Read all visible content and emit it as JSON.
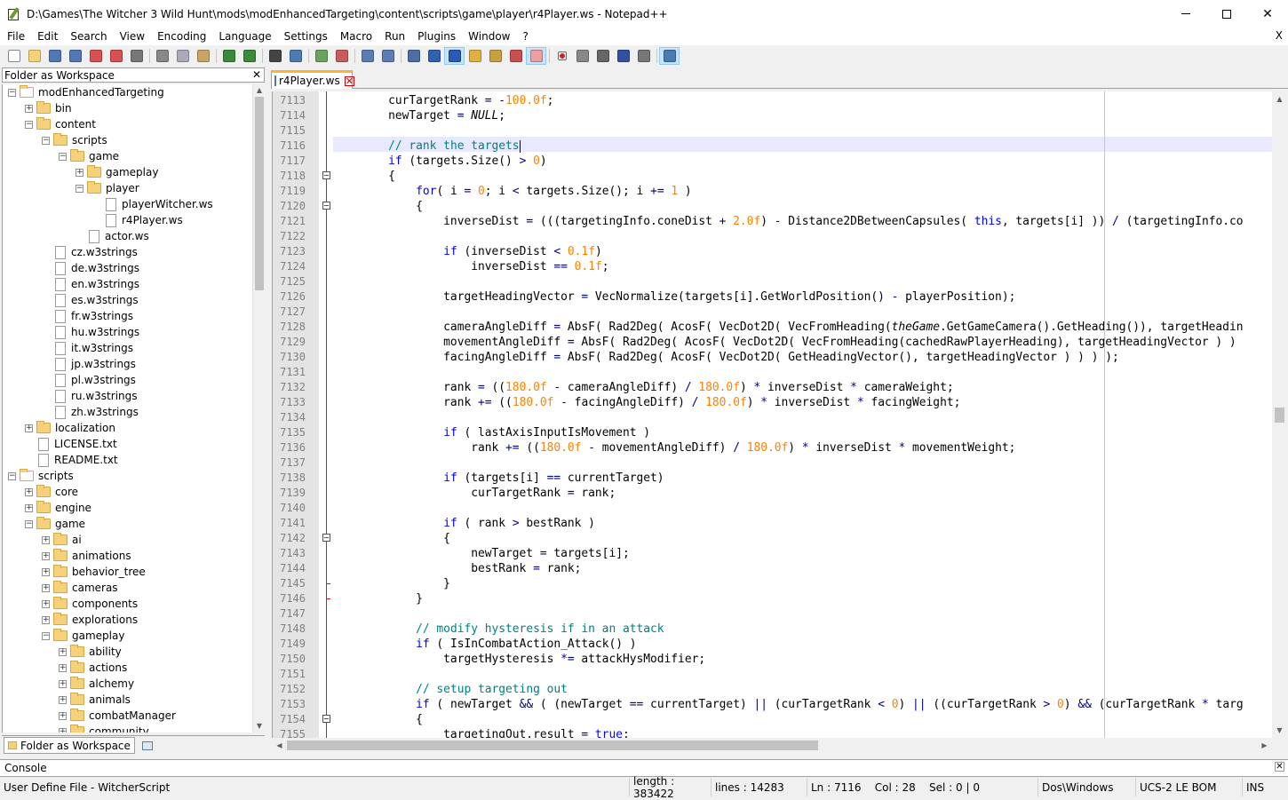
{
  "window": {
    "title": "D:\\Games\\The Witcher 3 Wild Hunt\\mods\\modEnhancedTargeting\\content\\scripts\\game\\player\\r4Player.ws - Notepad++"
  },
  "menu": [
    "File",
    "Edit",
    "Search",
    "View",
    "Encoding",
    "Language",
    "Settings",
    "Macro",
    "Run",
    "Plugins",
    "Window",
    "?"
  ],
  "menu_close_doc": "X",
  "toolbar_icons": [
    "new-file-icon",
    "open-file-icon",
    "save-icon",
    "save-all-icon",
    "close-icon",
    "close-all-icon",
    "print-icon",
    "cut-icon",
    "copy-icon",
    "paste-icon",
    "undo-icon",
    "redo-icon",
    "find-icon",
    "replace-icon",
    "zoom-in-icon",
    "zoom-out-icon",
    "sync-vertical-icon",
    "sync-horizontal-icon",
    "word-wrap-icon",
    "show-all-chars-icon",
    "indent-guide-icon",
    "user-language-icon",
    "document-map-icon",
    "function-list-icon",
    "folder-as-workspace-icon",
    "record-macro-icon",
    "stop-macro-icon",
    "play-macro-icon",
    "run-macro-multiple-icon",
    "save-macro-icon",
    "monitoring-icon"
  ],
  "panel": {
    "title": "Folder as Workspace",
    "close": "✕",
    "tab_label": "Folder as Workspace",
    "tree": [
      {
        "label": "modEnhancedTargeting",
        "depth": 0,
        "kind": "folder",
        "exp": "−"
      },
      {
        "label": "bin",
        "depth": 1,
        "kind": "folder",
        "exp": "+"
      },
      {
        "label": "content",
        "depth": 1,
        "kind": "folder",
        "exp": "−"
      },
      {
        "label": "scripts",
        "depth": 2,
        "kind": "folder",
        "exp": "−"
      },
      {
        "label": "game",
        "depth": 3,
        "kind": "folder",
        "exp": "−"
      },
      {
        "label": "gameplay",
        "depth": 4,
        "kind": "folder",
        "exp": "+"
      },
      {
        "label": "player",
        "depth": 4,
        "kind": "folder",
        "exp": "−"
      },
      {
        "label": "playerWitcher.ws",
        "depth": 5,
        "kind": "file",
        "exp": ""
      },
      {
        "label": "r4Player.ws",
        "depth": 5,
        "kind": "file",
        "exp": ""
      },
      {
        "label": "actor.ws",
        "depth": 4,
        "kind": "file",
        "exp": ""
      },
      {
        "label": "cz.w3strings",
        "depth": 2,
        "kind": "file",
        "exp": ""
      },
      {
        "label": "de.w3strings",
        "depth": 2,
        "kind": "file",
        "exp": ""
      },
      {
        "label": "en.w3strings",
        "depth": 2,
        "kind": "file",
        "exp": ""
      },
      {
        "label": "es.w3strings",
        "depth": 2,
        "kind": "file",
        "exp": ""
      },
      {
        "label": "fr.w3strings",
        "depth": 2,
        "kind": "file",
        "exp": ""
      },
      {
        "label": "hu.w3strings",
        "depth": 2,
        "kind": "file",
        "exp": ""
      },
      {
        "label": "it.w3strings",
        "depth": 2,
        "kind": "file",
        "exp": ""
      },
      {
        "label": "jp.w3strings",
        "depth": 2,
        "kind": "file",
        "exp": ""
      },
      {
        "label": "pl.w3strings",
        "depth": 2,
        "kind": "file",
        "exp": ""
      },
      {
        "label": "ru.w3strings",
        "depth": 2,
        "kind": "file",
        "exp": ""
      },
      {
        "label": "zh.w3strings",
        "depth": 2,
        "kind": "file",
        "exp": ""
      },
      {
        "label": "localization",
        "depth": 1,
        "kind": "folder",
        "exp": "+"
      },
      {
        "label": "LICENSE.txt",
        "depth": 1,
        "kind": "file",
        "exp": ""
      },
      {
        "label": "README.txt",
        "depth": 1,
        "kind": "file",
        "exp": ""
      },
      {
        "label": "scripts",
        "depth": 0,
        "kind": "folder",
        "exp": "−"
      },
      {
        "label": "core",
        "depth": 1,
        "kind": "folder",
        "exp": "+"
      },
      {
        "label": "engine",
        "depth": 1,
        "kind": "folder",
        "exp": "+"
      },
      {
        "label": "game",
        "depth": 1,
        "kind": "folder",
        "exp": "−"
      },
      {
        "label": "ai",
        "depth": 2,
        "kind": "folder",
        "exp": "+"
      },
      {
        "label": "animations",
        "depth": 2,
        "kind": "folder",
        "exp": "+"
      },
      {
        "label": "behavior_tree",
        "depth": 2,
        "kind": "folder",
        "exp": "+"
      },
      {
        "label": "cameras",
        "depth": 2,
        "kind": "folder",
        "exp": "+"
      },
      {
        "label": "components",
        "depth": 2,
        "kind": "folder",
        "exp": "+"
      },
      {
        "label": "explorations",
        "depth": 2,
        "kind": "folder",
        "exp": "+"
      },
      {
        "label": "gameplay",
        "depth": 2,
        "kind": "folder",
        "exp": "−"
      },
      {
        "label": "ability",
        "depth": 3,
        "kind": "folder",
        "exp": "+"
      },
      {
        "label": "actions",
        "depth": 3,
        "kind": "folder",
        "exp": "+"
      },
      {
        "label": "alchemy",
        "depth": 3,
        "kind": "folder",
        "exp": "+"
      },
      {
        "label": "animals",
        "depth": 3,
        "kind": "folder",
        "exp": "+"
      },
      {
        "label": "combatManager",
        "depth": 3,
        "kind": "folder",
        "exp": "+"
      },
      {
        "label": "community",
        "depth": 3,
        "kind": "folder",
        "exp": "+"
      }
    ]
  },
  "editor": {
    "tab": "r4Player.ws",
    "lines": [
      {
        "n": "7113",
        "text": "\t\tcurTargetRank = -100.0f;"
      },
      {
        "n": "7114",
        "text": "\t\tnewTarget = NULL;"
      },
      {
        "n": "7115",
        "text": ""
      },
      {
        "n": "7116",
        "text": "\t\t// rank the targets"
      },
      {
        "n": "7117",
        "text": "\t\tif (targets.Size() > 0)"
      },
      {
        "n": "7118",
        "text": "\t\t{"
      },
      {
        "n": "7119",
        "text": "\t\t\tfor( i = 0; i < targets.Size(); i += 1 )"
      },
      {
        "n": "7120",
        "text": "\t\t\t{"
      },
      {
        "n": "7121",
        "text": "\t\t\t\tinverseDist = (((targetingInfo.coneDist + 2.0f) - Distance2DBetweenCapsules( this, targets[i] )) / (targetingInfo.co"
      },
      {
        "n": "7122",
        "text": ""
      },
      {
        "n": "7123",
        "text": "\t\t\t\tif (inverseDist < 0.1f)"
      },
      {
        "n": "7124",
        "text": "\t\t\t\t\tinverseDist == 0.1f;"
      },
      {
        "n": "7125",
        "text": ""
      },
      {
        "n": "7126",
        "text": "\t\t\t\ttargetHeadingVector = VecNormalize(targets[i].GetWorldPosition() - playerPosition);"
      },
      {
        "n": "7127",
        "text": ""
      },
      {
        "n": "7128",
        "text": "\t\t\t\tcameraAngleDiff = AbsF( Rad2Deg( AcosF( VecDot2D( VecFromHeading(theGame.GetGameCamera().GetHeading()), targetHeadin"
      },
      {
        "n": "7129",
        "text": "\t\t\t\tmovementAngleDiff = AbsF( Rad2Deg( AcosF( VecDot2D( VecFromHeading(cachedRawPlayerHeading), targetHeadingVector ) )"
      },
      {
        "n": "7130",
        "text": "\t\t\t\tfacingAngleDiff = AbsF( Rad2Deg( AcosF( VecDot2D( GetHeadingVector(), targetHeadingVector ) ) ) );"
      },
      {
        "n": "7131",
        "text": ""
      },
      {
        "n": "7132",
        "text": "\t\t\t\trank = ((180.0f - cameraAngleDiff) / 180.0f) * inverseDist * cameraWeight;"
      },
      {
        "n": "7133",
        "text": "\t\t\t\trank += ((180.0f - facingAngleDiff) / 180.0f) * inverseDist * facingWeight;"
      },
      {
        "n": "7134",
        "text": ""
      },
      {
        "n": "7135",
        "text": "\t\t\t\tif ( lastAxisInputIsMovement )"
      },
      {
        "n": "7136",
        "text": "\t\t\t\t\trank += ((180.0f - movementAngleDiff) / 180.0f) * inverseDist * movementWeight;"
      },
      {
        "n": "7137",
        "text": ""
      },
      {
        "n": "7138",
        "text": "\t\t\t\tif (targets[i] == currentTarget)"
      },
      {
        "n": "7139",
        "text": "\t\t\t\t\tcurTargetRank = rank;"
      },
      {
        "n": "7140",
        "text": ""
      },
      {
        "n": "7141",
        "text": "\t\t\t\tif ( rank > bestRank )"
      },
      {
        "n": "7142",
        "text": "\t\t\t\t{"
      },
      {
        "n": "7143",
        "text": "\t\t\t\t\tnewTarget = targets[i];"
      },
      {
        "n": "7144",
        "text": "\t\t\t\t\tbestRank = rank;"
      },
      {
        "n": "7145",
        "text": "\t\t\t\t}"
      },
      {
        "n": "7146",
        "text": "\t\t\t}"
      },
      {
        "n": "7147",
        "text": ""
      },
      {
        "n": "7148",
        "text": "\t\t\t// modify hysteresis if in an attack"
      },
      {
        "n": "7149",
        "text": "\t\t\tif ( IsInCombatAction_Attack() )"
      },
      {
        "n": "7150",
        "text": "\t\t\t\ttargetHysteresis *= attackHysModifier;"
      },
      {
        "n": "7151",
        "text": ""
      },
      {
        "n": "7152",
        "text": "\t\t\t// setup targeting out"
      },
      {
        "n": "7153",
        "text": "\t\t\tif ( newTarget && ( (newTarget == currentTarget) || (curTargetRank < 0) || ((curTargetRank > 0) && (curTargetRank * targ"
      },
      {
        "n": "7154",
        "text": "\t\t\t{"
      },
      {
        "n": "7155",
        "text": "\t\t\t\ttargetingOut.result = true;"
      }
    ],
    "fold_markers": [
      "7118",
      "7120",
      "7142",
      "7154"
    ],
    "fold_ends": [
      "7145",
      "7146"
    ],
    "current_line": "7116"
  },
  "console": {
    "label": "Console",
    "close": "✕"
  },
  "status": {
    "language": "User Define File - WitcherScript",
    "length": "length : 383422",
    "lines": "lines : 14283",
    "position": "Ln : 7116    Col : 28    Sel : 0 | 0",
    "eol": "Dos\\Windows",
    "encoding": "UCS-2 LE BOM",
    "mode": "INS"
  }
}
